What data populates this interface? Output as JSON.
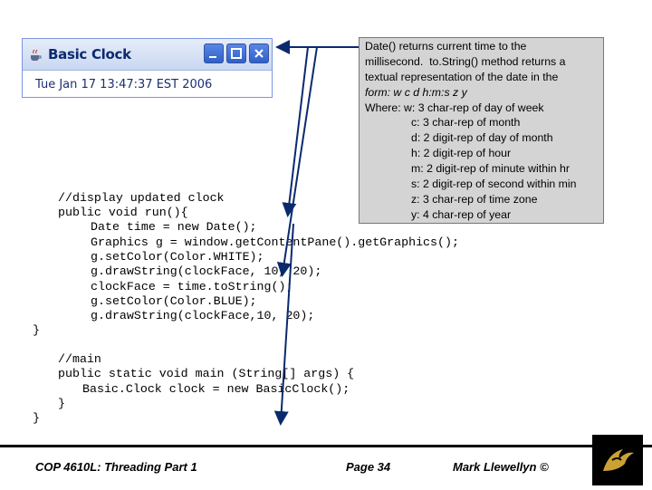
{
  "window": {
    "title": "Basic Clock",
    "clock_text": "Tue Jan 17 13:47:37 EST 2006",
    "icons": [
      "java-cup-icon",
      "minimize-icon",
      "maximize-icon",
      "close-icon"
    ]
  },
  "callout": {
    "lines": [
      "Date() returns current time to the",
      "millisecond.  to.String() method returns a",
      "textual representation of the date in the",
      "form: w c d h:m:s z y",
      "Where: w: 3 char-rep of day of week",
      "c: 3 char-rep of month",
      "d: 2 digit-rep of day of month",
      "h: 2 digit-rep of hour",
      "m: 2 digit-rep of minute within hr",
      "s: 2 digit-rep of second within min",
      "z: 3 char-rep of time zone",
      "y: 4 char-rep of year"
    ]
  },
  "code": {
    "lines": [
      "//display updated clock",
      "public void run(){",
      "Date time = new Date();",
      "Graphics g = window.getContentPane().getGraphics();",
      "g.setColor(Color.WHITE);",
      "g.drawString(clockFace, 10, 20);",
      "clockFace = time.toString();",
      "g.setColor(Color.BLUE);",
      "g.drawString(clockFace,10, 20);",
      "}",
      "//main",
      "public static void main (String[] args) {",
      "Basic.Clock clock = new BasicClock();",
      "}",
      "}"
    ]
  },
  "footer": {
    "course": "COP 4610L: Threading Part 1",
    "page": "Page 34",
    "author": "Mark Llewellyn ©"
  },
  "colors": {
    "callout_bg": "#d4d4d4",
    "titlebar": "#c9d7f2",
    "window_button": "#2f5fc9",
    "close_x": "#ffffff",
    "arrow": "#0a2a6e"
  }
}
